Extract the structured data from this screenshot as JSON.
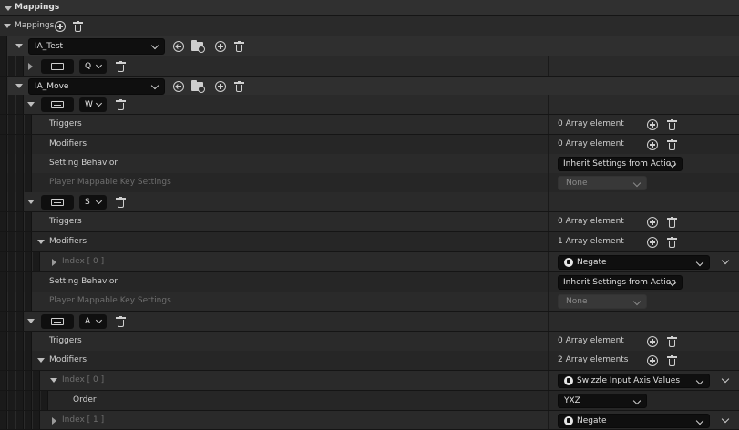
{
  "section": {
    "title": "Mappings"
  },
  "mappings_row": {
    "label": "Mappings"
  },
  "actions": [
    {
      "name": "IA_Test"
    },
    {
      "name": "IA_Move"
    }
  ],
  "ia_test_key": {
    "key": "Q"
  },
  "keys": {
    "w": {
      "key": "W"
    },
    "s": {
      "key": "S"
    },
    "a": {
      "key": "A"
    }
  },
  "w_details": {
    "triggers_label": "Triggers",
    "triggers_value": "0 Array element",
    "modifiers_label": "Modifiers",
    "modifiers_value": "0 Array element",
    "setting_label": "Setting Behavior",
    "setting_value": "Inherit Settings from Action",
    "player_label": "Player Mappable Key Settings",
    "player_value": "None"
  },
  "s_details": {
    "triggers_label": "Triggers",
    "triggers_value": "0 Array element",
    "modifiers_label": "Modifiers",
    "modifiers_value": "1 Array element",
    "index0_label": "Index [ 0 ]",
    "index0_value": "Negate",
    "setting_label": "Setting Behavior",
    "setting_value": "Inherit Settings from Action",
    "player_label": "Player Mappable Key Settings",
    "player_value": "None"
  },
  "a_details": {
    "triggers_label": "Triggers",
    "triggers_value": "0 Array element",
    "modifiers_label": "Modifiers",
    "modifiers_value": "2 Array elements",
    "index0_label": "Index [ 0 ]",
    "index0_value": "Swizzle Input Axis Values",
    "order_label": "Order",
    "order_value": "YXZ",
    "index1_label": "Index [ 1 ]",
    "index1_value": "Negate"
  },
  "icons": [
    "chevron-down-icon",
    "chevron-right-icon",
    "add-icon",
    "delete-icon",
    "browse-back-icon",
    "browse-folder-icon",
    "keyboard-icon",
    "modifier-icon"
  ]
}
